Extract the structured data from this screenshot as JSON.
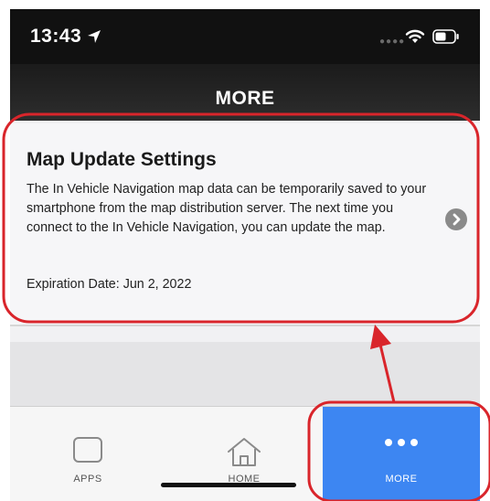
{
  "status_bar": {
    "time": "13:43"
  },
  "nav": {
    "title": "MORE"
  },
  "card": {
    "title": "Map Update Settings",
    "body": "The In Vehicle Navigation map data can be temporarily saved to your smartphone from the map distribution server. The next time you connect to the In Vehicle Navigation, you can update the map.",
    "expiry": "Expiration Date: Jun 2, 2022"
  },
  "tabs": [
    {
      "label": "APPS",
      "icon": "apps-icon"
    },
    {
      "label": "HOME",
      "icon": "home-icon"
    },
    {
      "label": "MORE",
      "icon": "more-icon",
      "selected": true
    }
  ],
  "colors": {
    "tab_selected": "#3d86f2",
    "annotation": "#d9252b"
  }
}
